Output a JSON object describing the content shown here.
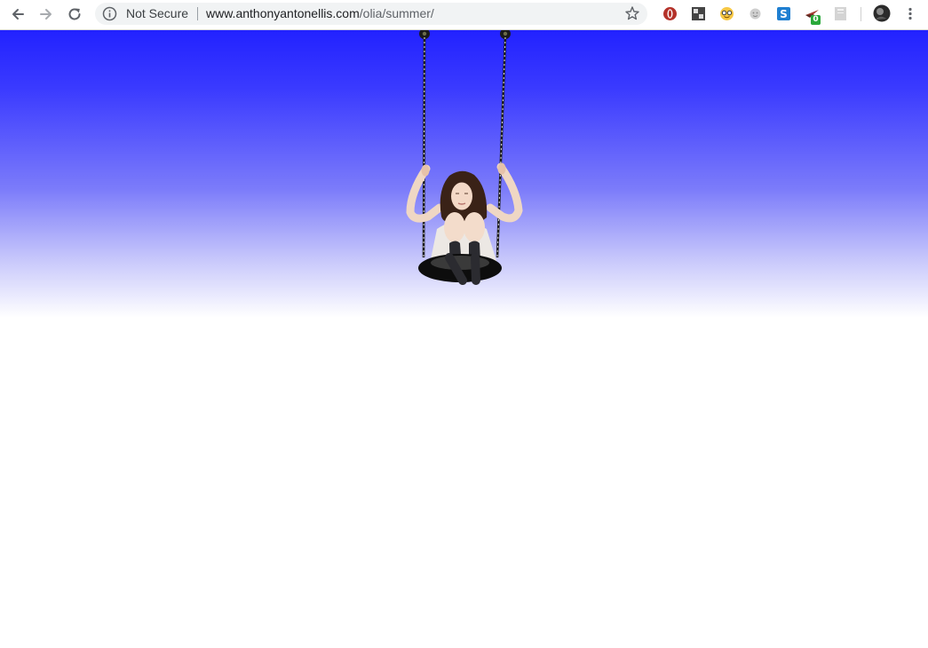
{
  "browser": {
    "security_label": "Not Secure",
    "url_host": "www.anthonyantonellis.com",
    "url_path": "/olia/summer/",
    "extensions": [
      {
        "icon": "opera-o-icon",
        "color": "#c0392b"
      },
      {
        "icon": "split-window-icon",
        "color": "#555555"
      },
      {
        "icon": "nerd-face-icon",
        "color": "#f5c542"
      },
      {
        "icon": "smiley-face-icon",
        "color": "#bbbbbb"
      },
      {
        "icon": "s-extension-icon",
        "color": "#1f7fd1"
      },
      {
        "icon": "glider-icon",
        "color": "#c0392b",
        "badge": "0"
      },
      {
        "icon": "document-icon",
        "color": "#cccccc"
      }
    ]
  },
  "page": {
    "sky_top_color": "#2222ff",
    "sky_bottom_color": "#ffffff",
    "main_image": "woman-on-tire-swing"
  }
}
